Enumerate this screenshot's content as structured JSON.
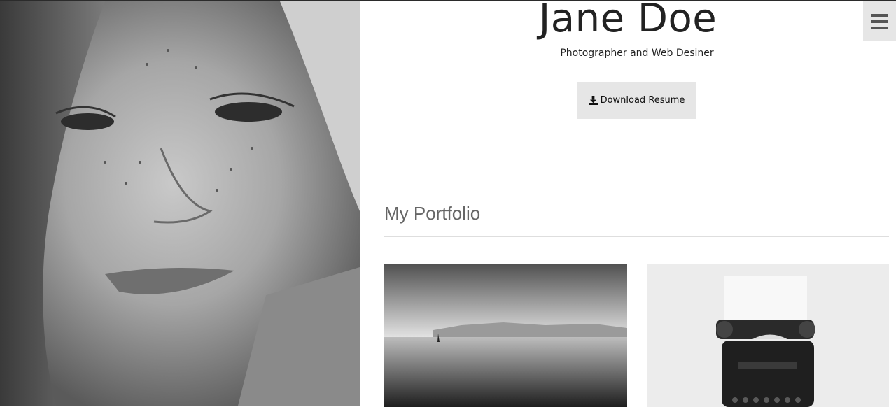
{
  "profile": {
    "name": "Jane Doe",
    "subtitle": "Photographer and Web Desiner"
  },
  "actions": {
    "download_resume_label": "Download Resume"
  },
  "portfolio": {
    "title": "My Portfolio",
    "items": [
      {
        "subject": "sea-horizon-sailboat"
      },
      {
        "subject": "vintage-typewriter"
      }
    ]
  },
  "menu": {
    "icon": "hamburger-menu-icon"
  },
  "colors": {
    "button_bg": "#e6e6e6",
    "section_title": "#666666",
    "text": "#222222"
  }
}
